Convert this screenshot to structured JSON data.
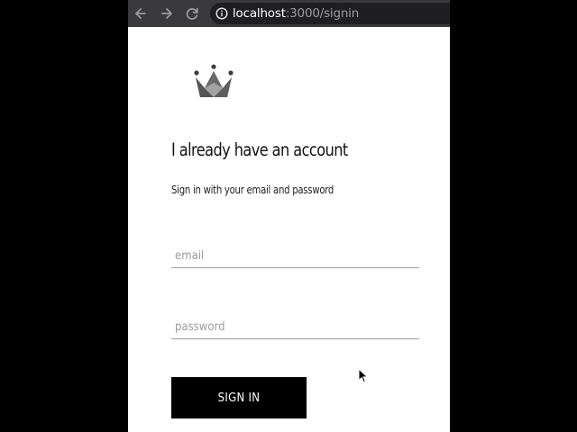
{
  "browser": {
    "url_host": "localhost",
    "url_path": ":3000/signin",
    "back_icon": "arrow-left-icon",
    "forward_icon": "arrow-right-icon",
    "reload_icon": "reload-icon",
    "info_icon": "info-circle-icon"
  },
  "logo": {
    "icon": "crown-icon"
  },
  "signin": {
    "title": "I already have an account",
    "subtitle": "Sign in with your email and password",
    "email_placeholder": "email",
    "email_value": "",
    "password_placeholder": "password",
    "password_value": "",
    "submit_label": "SIGN IN"
  },
  "colors": {
    "backdrop": "#000000",
    "page_background": "#ffffff",
    "toolbar": "#3a3a3c",
    "button": "#000000",
    "button_text": "#ffffff",
    "input_underline": "#9c9c9c"
  }
}
